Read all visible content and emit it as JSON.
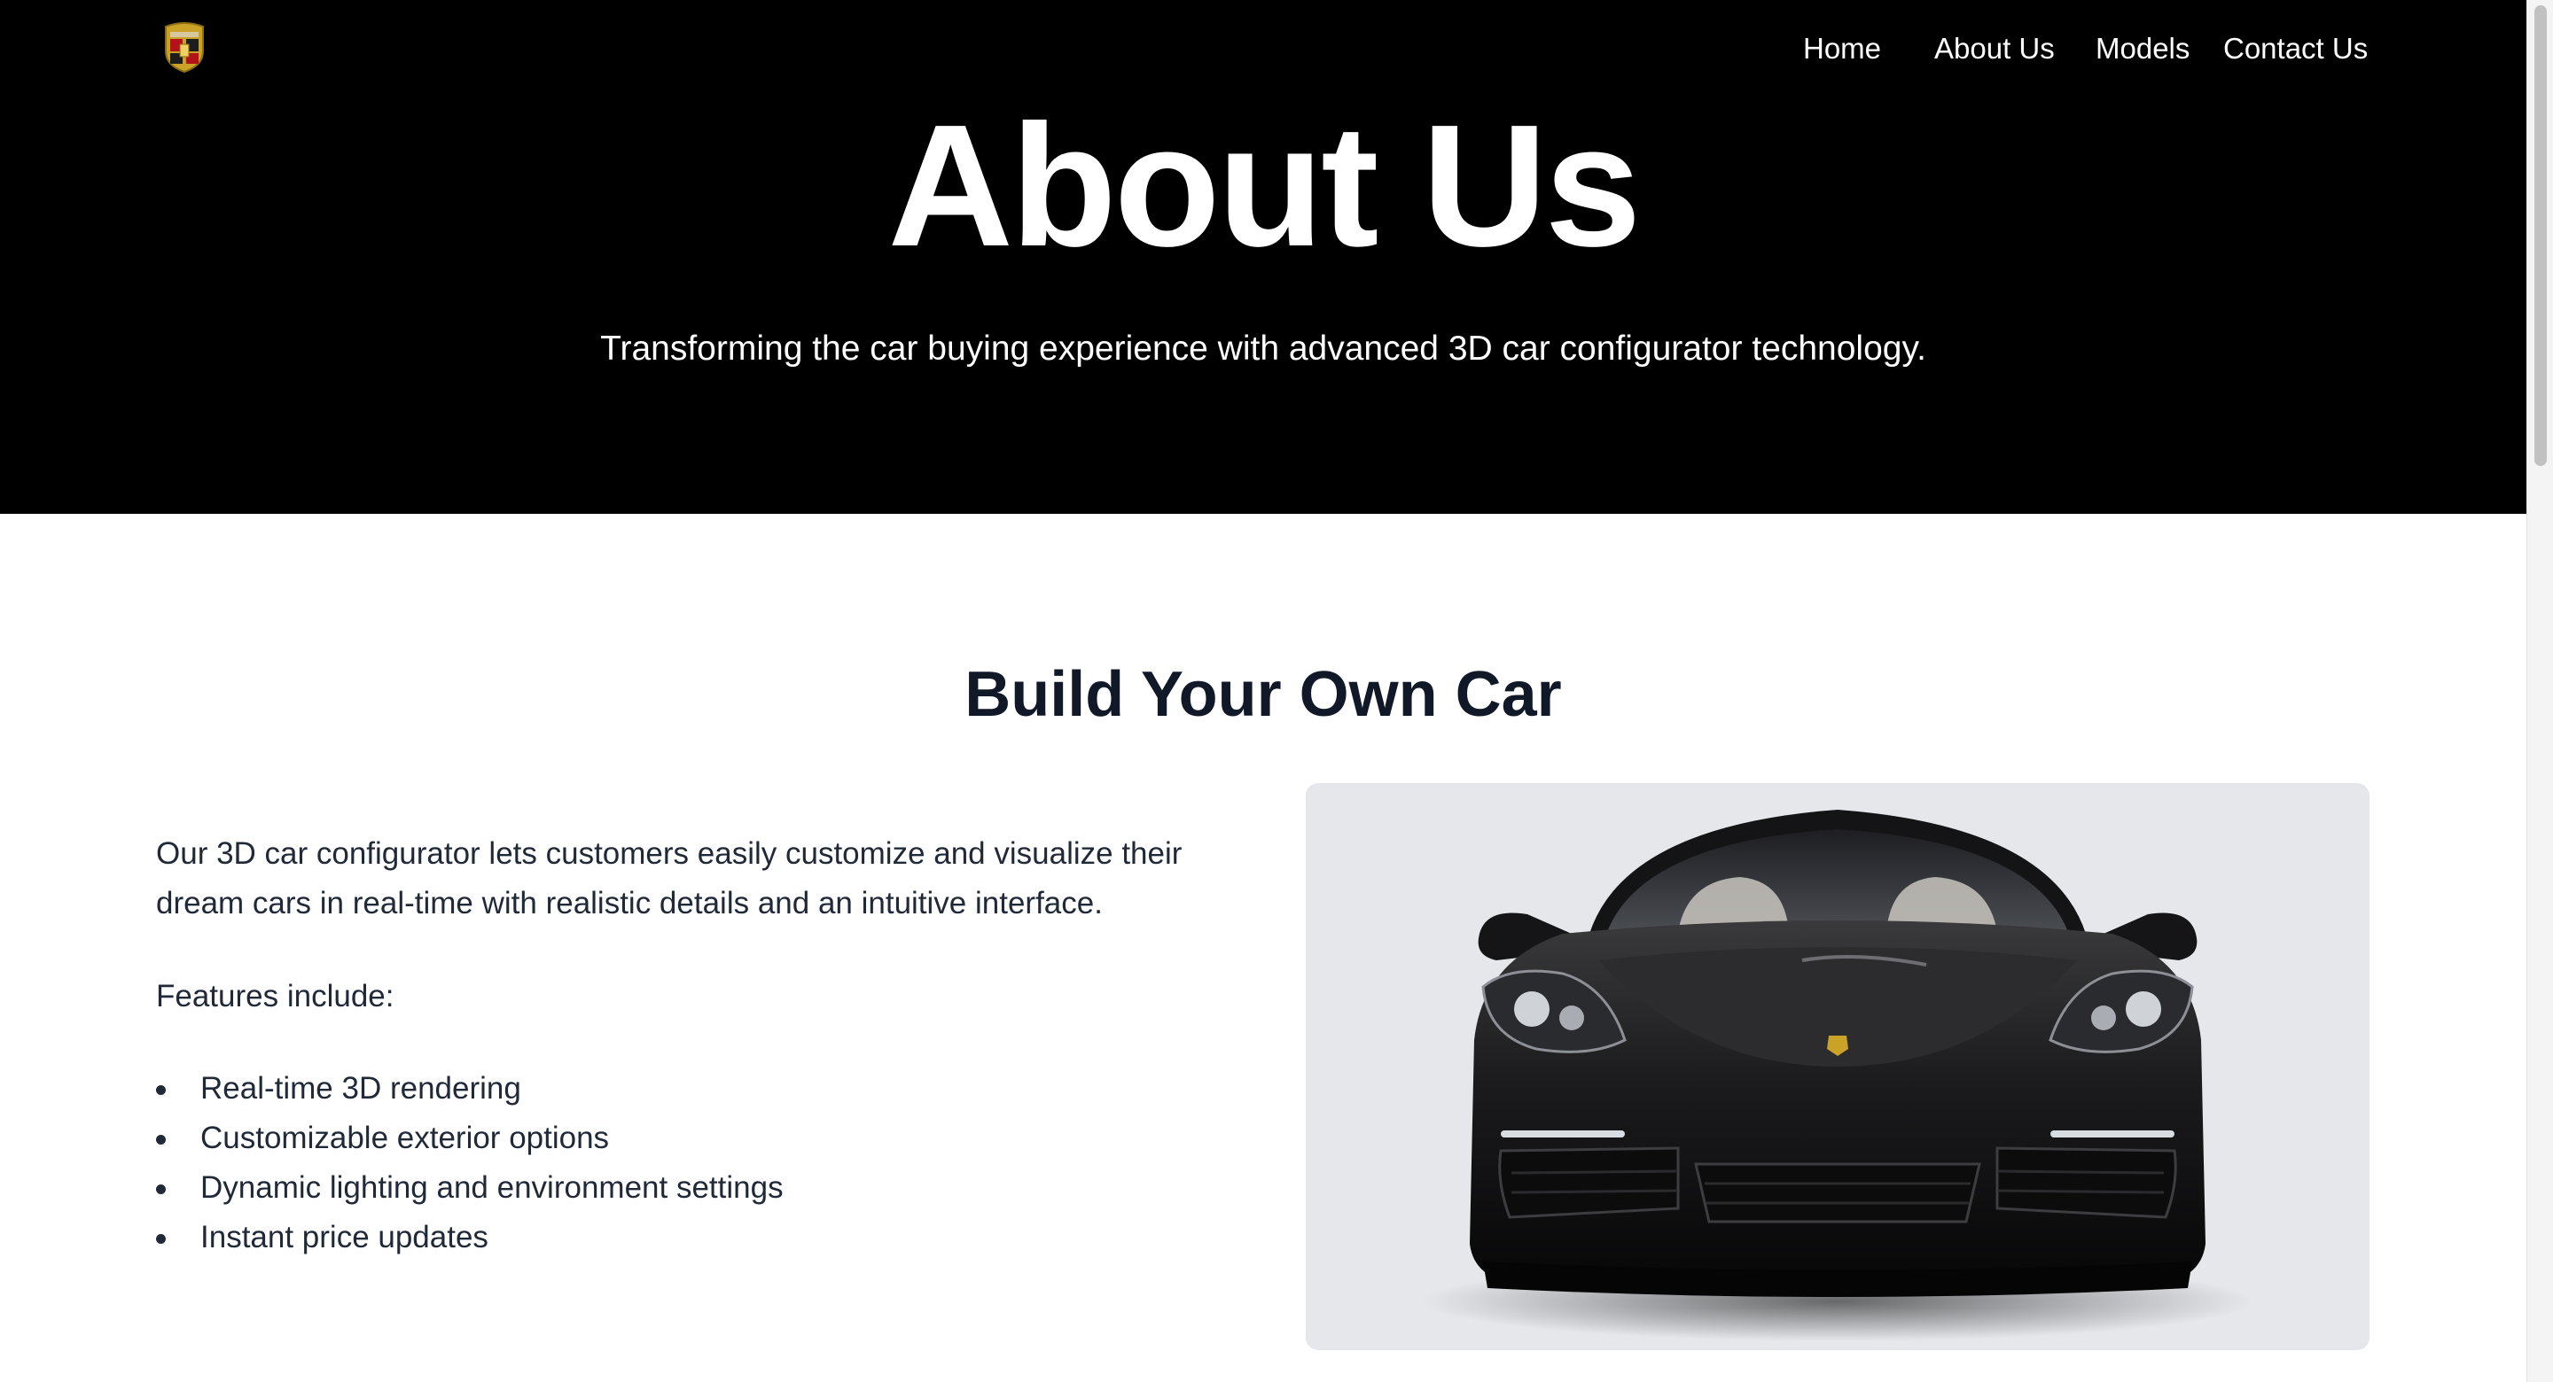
{
  "nav": {
    "items": [
      {
        "label": "Home"
      },
      {
        "label": "About Us"
      },
      {
        "label": "Models"
      },
      {
        "label": "Contact Us"
      }
    ]
  },
  "logo": {
    "icon": "crest-logo-icon"
  },
  "hero": {
    "title": "About Us",
    "subtitle": "Transforming the car buying experience with advanced 3D car configurator technology."
  },
  "section": {
    "title": "Build Your Own Car",
    "description": "Our 3D car configurator lets customers easily customize and visualize their dream cars in real-time with realistic details and an intuitive interface.",
    "features_label": "Features include:",
    "features": [
      "Real-time 3D rendering",
      "Customizable exterior options",
      "Dynamic lighting and environment settings",
      "Instant price updates"
    ]
  },
  "car_image": {
    "subject": "black sports car, front view"
  },
  "colors": {
    "hero_background": "#000000",
    "heading": "#111827",
    "body_text": "#1f2937",
    "card_background": "#e5e7eb"
  }
}
